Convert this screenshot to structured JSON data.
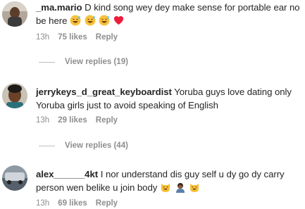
{
  "comments": [
    {
      "username": "_ma.mario",
      "text": "D kind song wey dey make sense for portable ear no be here",
      "emojis": [
        "grinning-sweat-icon",
        "grinning-sweat-icon",
        "grinning-sweat-icon",
        "red-heart-icon"
      ],
      "time": "13h",
      "likes": "75 likes",
      "reply_label": "Reply",
      "view_replies": "View replies (19)"
    },
    {
      "username": "jerrykeys_d_great_keyboardist",
      "text": "Yoruba guys love dating only Yoruba girls just to avoid speaking of English",
      "emojis": [],
      "time": "13h",
      "likes": "29 likes",
      "reply_label": "Reply",
      "view_replies": "View replies (44)"
    },
    {
      "username": "alex______4kt",
      "text": "I nor understand dis guy self u dy go dy carry person wen belike u join body",
      "emojis": [
        "grinning-cat-icon",
        "person-bowing-icon",
        "grinning-cat-icon"
      ],
      "time": "13h",
      "likes": "69 likes",
      "reply_label": "Reply"
    }
  ],
  "colors": {
    "text": "#262626",
    "meta": "#8e8e8e",
    "heart": "#ed1c3a",
    "emoji": "#f7c23a"
  }
}
